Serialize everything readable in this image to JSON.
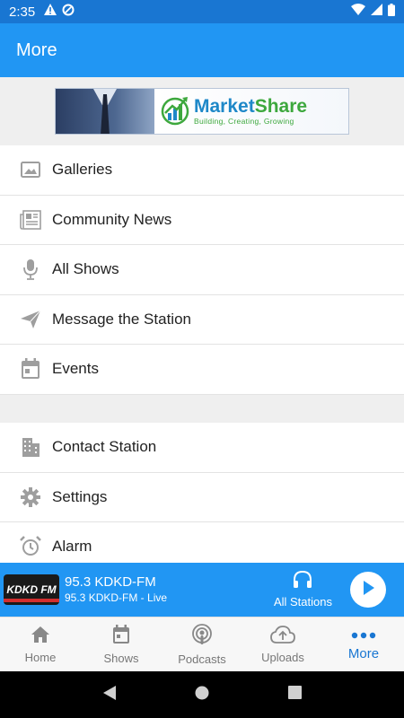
{
  "status_bar": {
    "time": "2:35"
  },
  "app_bar": {
    "title": "More"
  },
  "banner": {
    "brand_part1": "Market",
    "brand_part2": "Share",
    "tagline": "Building, Creating, Growing"
  },
  "menu_group_1": [
    {
      "label": "Galleries",
      "icon": "image-icon"
    },
    {
      "label": "Community News",
      "icon": "newspaper-icon"
    },
    {
      "label": "All Shows",
      "icon": "microphone-icon"
    },
    {
      "label": "Message the Station",
      "icon": "send-icon"
    },
    {
      "label": "Events",
      "icon": "calendar-icon"
    }
  ],
  "menu_group_2": [
    {
      "label": "Contact Station",
      "icon": "building-icon"
    },
    {
      "label": "Settings",
      "icon": "gear-icon"
    },
    {
      "label": "Alarm",
      "icon": "alarm-clock-icon"
    }
  ],
  "player": {
    "logo_text": "KDKD FM",
    "title": "95.3 KDKD-FM",
    "subtitle": "95.3 KDKD-FM - Live",
    "all_stations_label": "All Stations"
  },
  "tabs": [
    {
      "label": "Home",
      "icon": "home-icon"
    },
    {
      "label": "Shows",
      "icon": "calendar-icon"
    },
    {
      "label": "Podcasts",
      "icon": "podcast-icon"
    },
    {
      "label": "Uploads",
      "icon": "cloud-upload-icon"
    },
    {
      "label": "More",
      "icon": "more-dots-icon",
      "active": true
    }
  ],
  "colors": {
    "primary": "#2196f3",
    "status_bar": "#1976d2",
    "icon_gray": "#9e9e9e"
  }
}
